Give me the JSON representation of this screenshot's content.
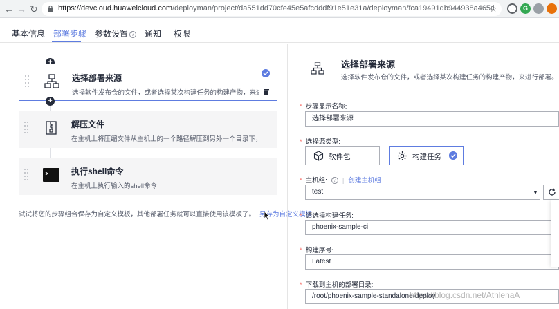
{
  "browser": {
    "url_host": "https://devcloud.huaweicloud.com",
    "url_path": "/deployman/project/da551dd70cfe45e5afcdddf91e51e31a/deployman/fca19491db944938a465df548..."
  },
  "tabs": [
    {
      "label": "基本信息"
    },
    {
      "label": "部署步骤"
    },
    {
      "label": "参数设置"
    },
    {
      "label": "通知"
    },
    {
      "label": "权限"
    }
  ],
  "steps": [
    {
      "title": "选择部署来源",
      "desc": "选择软件发布仓的文件，或者选择某次构建任务的构建产物，来进行部署..."
    },
    {
      "title": "解压文件",
      "desc": "在主机上将压缩文件从主机上的一个路径解压到另外一个目录下，支持多..."
    },
    {
      "title": "执行shell命令",
      "desc": "在主机上执行输入的shell命令"
    }
  ],
  "template_note": {
    "text": "试试将您的步骤组合保存为自定义模板，其他部署任务就可以直接使用该模板了。",
    "link": "另存为自定义模板"
  },
  "detail": {
    "title": "选择部署来源",
    "desc": "选择软件发布仓的文件，或者选择某次构建任务的构建产物，来进行部署。...",
    "fields": {
      "step_name_label": "步骤显示名称:",
      "step_name_value": "选择部署来源",
      "source_type_label": "选择源类型:",
      "source_options": [
        "软件包",
        "构建任务"
      ],
      "host_group_label": "主机组:",
      "create_host_group": "创建主机组",
      "host_group_value": "test",
      "build_task_label": "请选择构建任务:",
      "build_task_value": "phoenix-sample-ci",
      "build_no_label": "构建序号:",
      "build_no_value": "Latest",
      "download_dir_label": "下载到主机的部署目录:",
      "download_dir_value": "/root/phoenix-sample-standalone-deploy"
    }
  },
  "watermark": "https://blog.csdn.net/AthlenaA",
  "colors": {
    "accent": "#5e7ce0",
    "required": "#f66f6a"
  }
}
